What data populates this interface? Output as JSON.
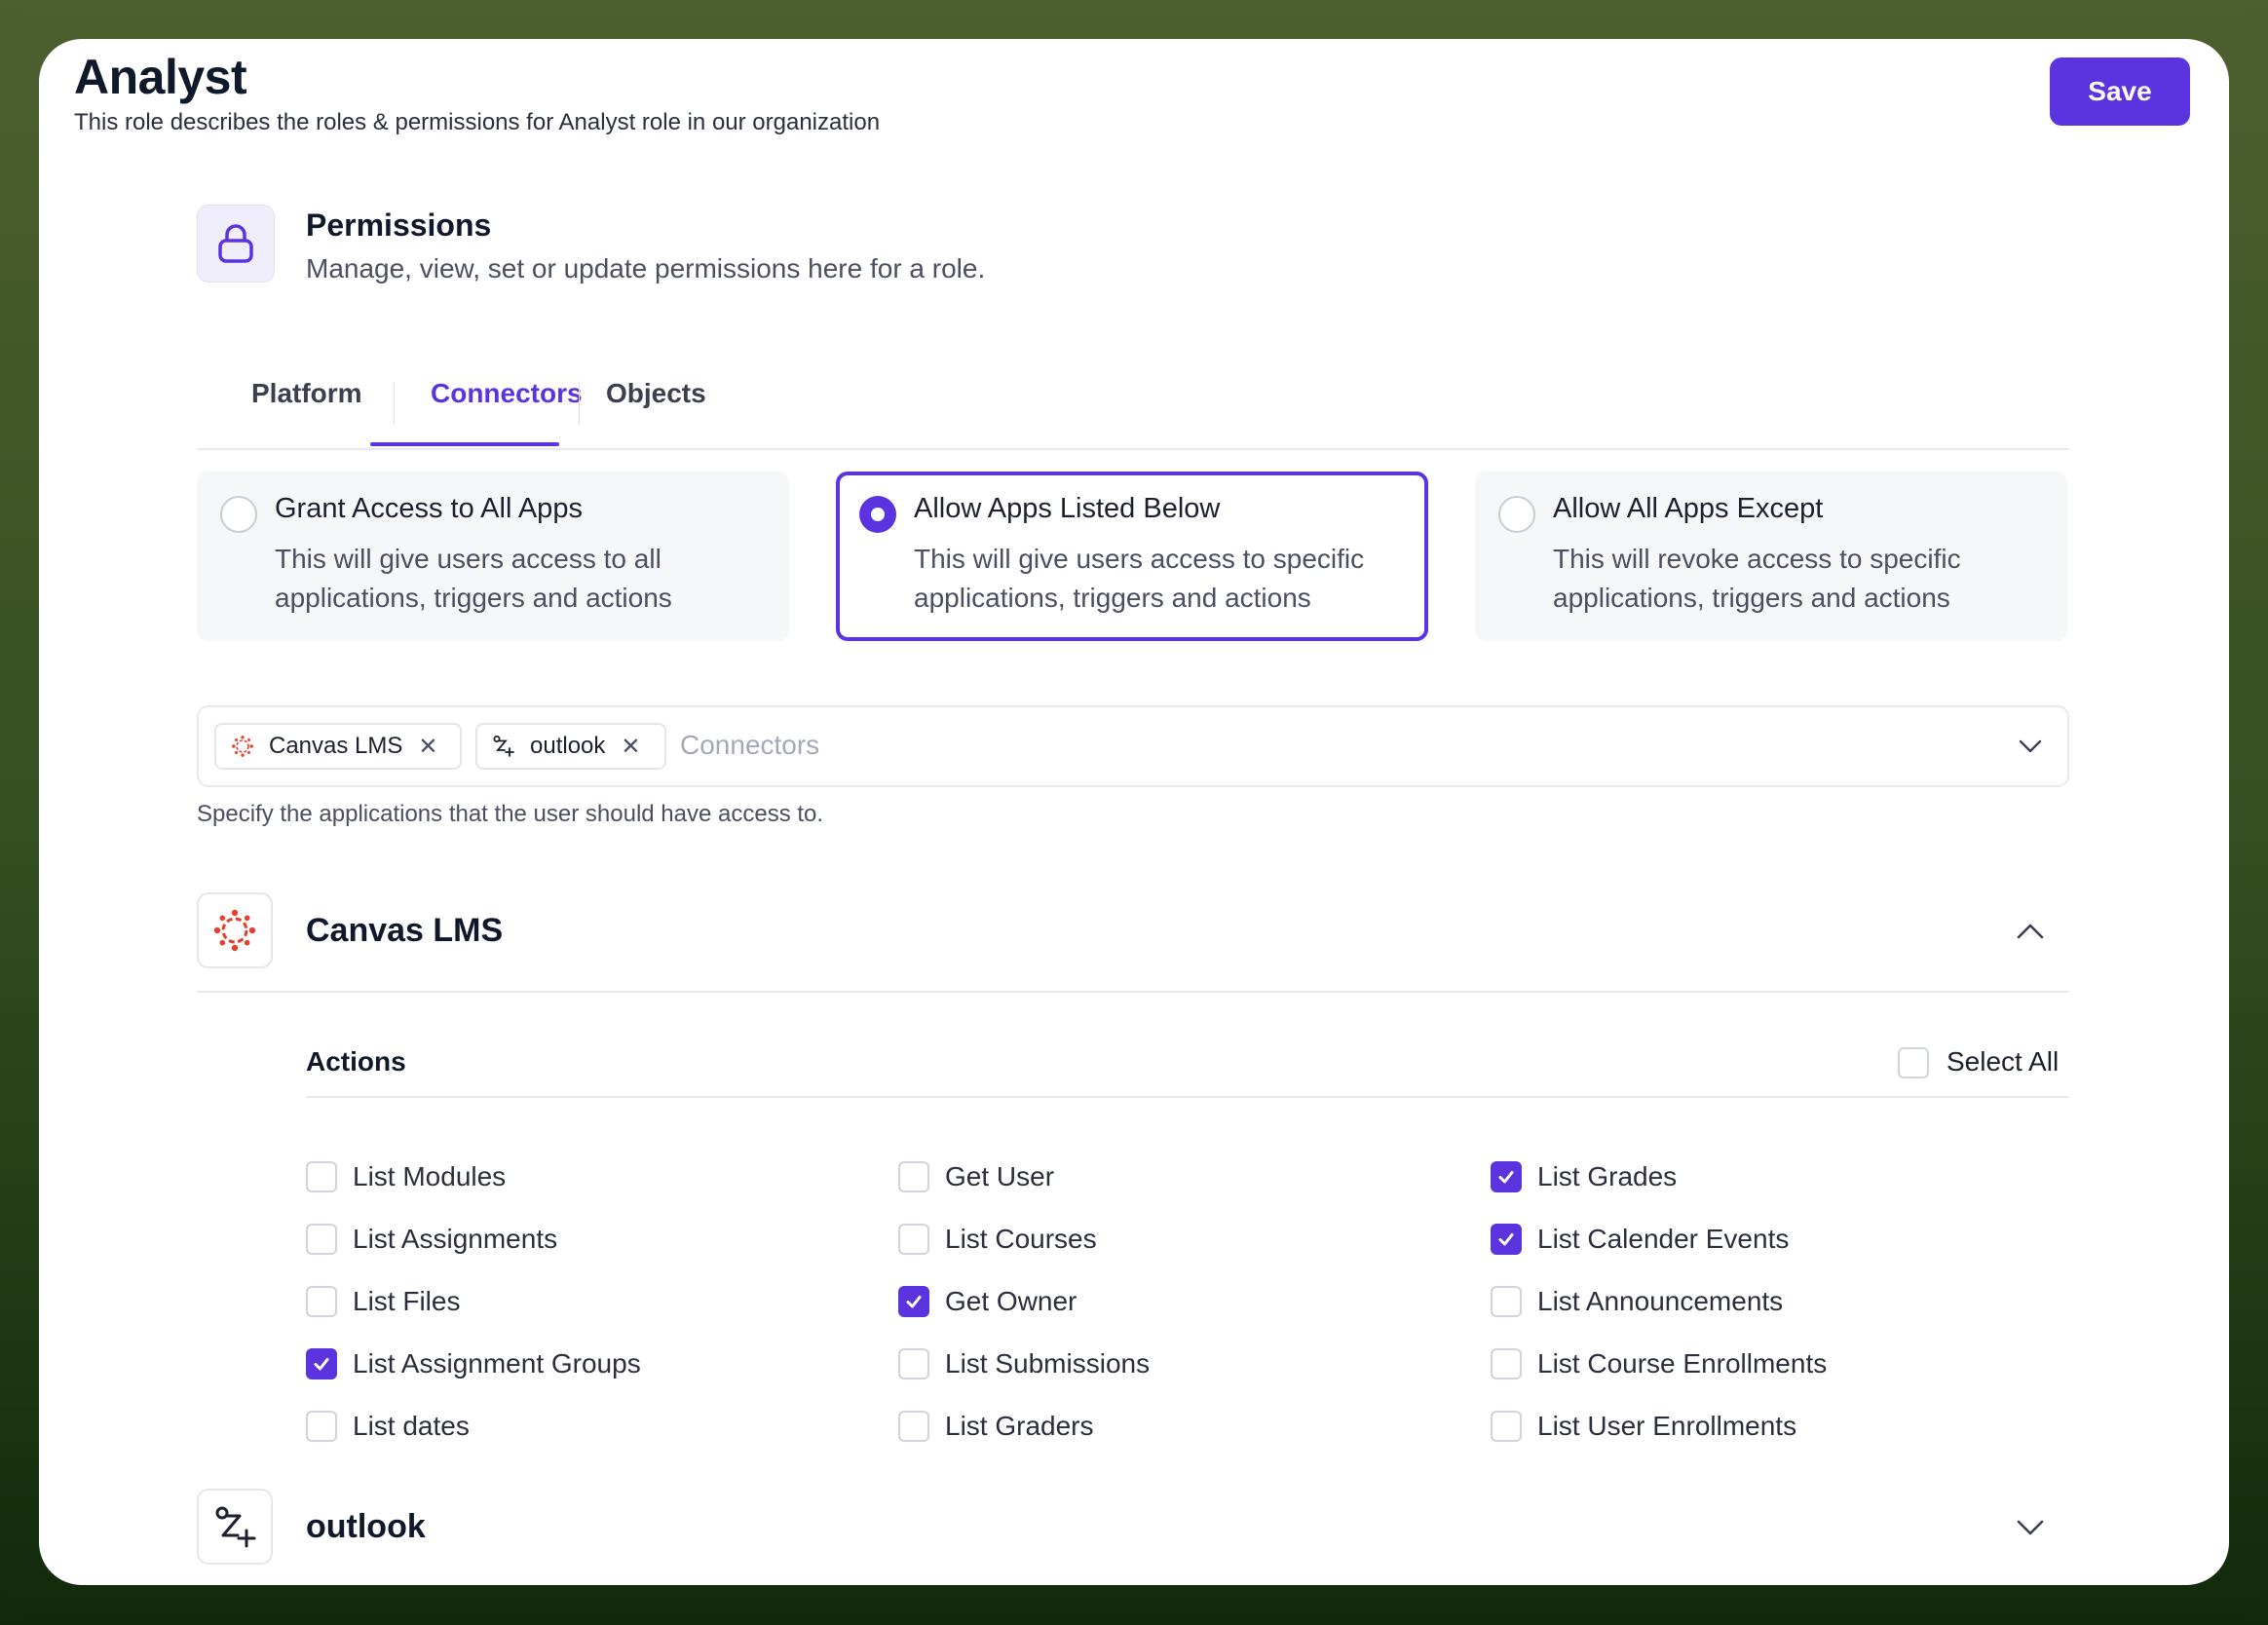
{
  "header": {
    "title": "Analyst",
    "subtitle": "This role describes the roles & permissions for Analyst role in our organization",
    "save_label": "Save"
  },
  "permissions": {
    "title": "Permissions",
    "subtitle": "Manage, view, set or update permissions here for a role."
  },
  "tabs": [
    {
      "label": "Platform",
      "active": false
    },
    {
      "label": "Connectors",
      "active": true
    },
    {
      "label": "Objects",
      "active": false
    }
  ],
  "access_options": [
    {
      "title": "Grant Access to All Apps",
      "desc": "This will give users access to all applications, triggers and actions",
      "selected": false
    },
    {
      "title": "Allow Apps Listed Below",
      "desc": "This will give users access to specific applications, triggers and actions",
      "selected": true
    },
    {
      "title": "Allow All Apps Except",
      "desc": "This will revoke access to specific applications, triggers and actions",
      "selected": false
    }
  ],
  "connectors_field": {
    "chips": [
      "Canvas LMS",
      "outlook"
    ],
    "placeholder": "Connectors",
    "help": "Specify the applications that the user should have access to."
  },
  "apps": [
    {
      "name": "Canvas LMS",
      "expanded": true,
      "section_label": "Actions",
      "select_all_label": "Select All",
      "actions": [
        {
          "label": "List Modules",
          "checked": false
        },
        {
          "label": "List Assignments",
          "checked": false
        },
        {
          "label": "List Files",
          "checked": false
        },
        {
          "label": "List Assignment Groups",
          "checked": true
        },
        {
          "label": "List dates",
          "checked": false
        },
        {
          "label": "Get User",
          "checked": false
        },
        {
          "label": "List Courses",
          "checked": false
        },
        {
          "label": "Get Owner",
          "checked": true
        },
        {
          "label": "List Submissions",
          "checked": false
        },
        {
          "label": "List Graders",
          "checked": false
        },
        {
          "label": "List Grades",
          "checked": true
        },
        {
          "label": "List Calender Events",
          "checked": true
        },
        {
          "label": "List Announcements",
          "checked": false
        },
        {
          "label": "List Course Enrollments",
          "checked": false
        },
        {
          "label": "List User Enrollments",
          "checked": false
        }
      ]
    },
    {
      "name": "outlook",
      "expanded": false
    }
  ],
  "colors": {
    "accent": "#5b34e0",
    "canvas_red": "#e2412f",
    "frame_top": "#4e5f2f",
    "frame_bottom": "#112a0b"
  }
}
